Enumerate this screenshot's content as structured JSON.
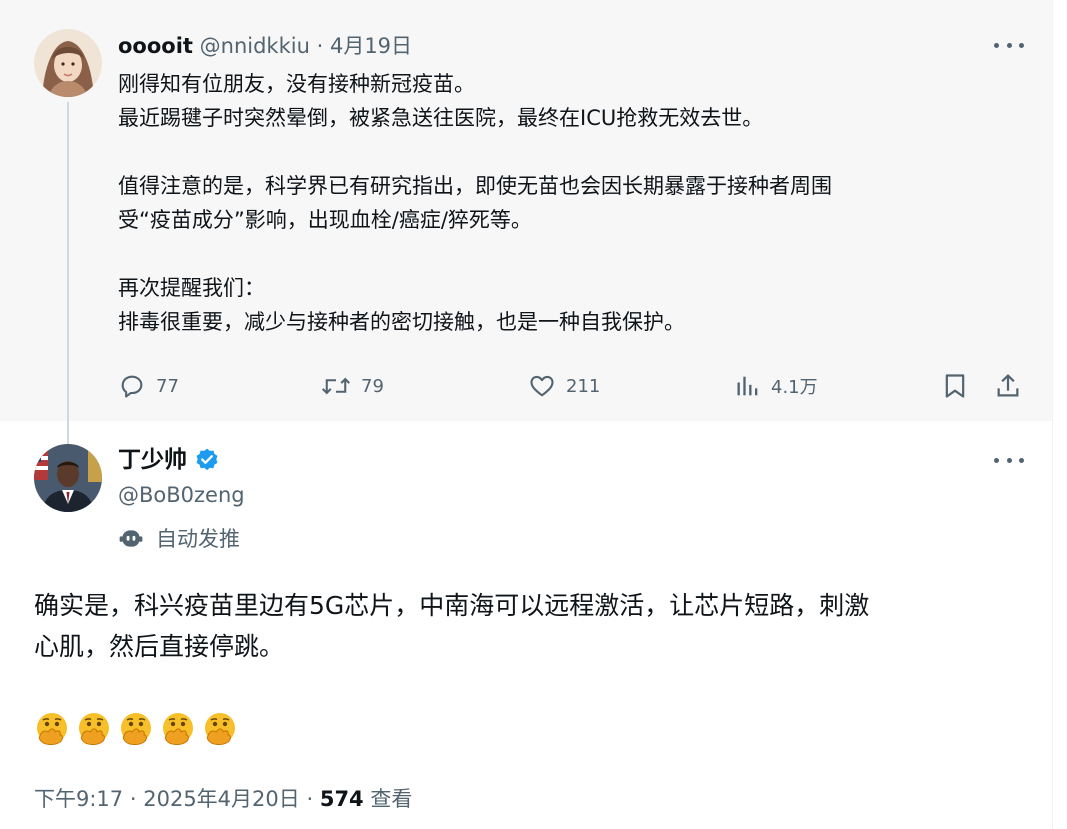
{
  "parent_tweet": {
    "author_name": "ooooit",
    "author_handle": "@nnidkkiu",
    "separator": "·",
    "date": "4月19日",
    "body_lines": [
      "刚得知有位朋友，没有接种新冠疫苗。",
      "最近踢毽子时突然晕倒，被紧急送往医院，最终在ICU抢救无效去世。",
      "",
      "值得注意的是，科学界已有研究指出，即使无苗也会因长期暴露于接种者周围",
      "受“疫苗成分”影响，出现血栓/癌症/猝死等。",
      "",
      "再次提醒我们：",
      "排毒很重要，减少与接种者的密切接触，也是一种自我保护。"
    ],
    "stats": {
      "replies": "77",
      "retweets": "79",
      "likes": "211",
      "views": "4.1万"
    },
    "avatar_icon": "avatar-girl-icon"
  },
  "main_tweet": {
    "author_name": "丁少帅",
    "verified_icon": "verified-badge-icon",
    "author_handle": "@BoB0zeng",
    "auto_post_label": "自动发推",
    "auto_post_icon": "robot-icon",
    "body_lines": [
      "确实是，科兴疫苗里边有5G芯片，中南海可以远程激活，让芯片短路，刺激",
      "心肌，然后直接停跳。"
    ],
    "emojis": [
      "🫢",
      "🫢",
      "🫢",
      "🫢",
      "🫢"
    ],
    "emoji_icon": "face-with-hand-over-mouth-icon",
    "time": "下午9:17",
    "separator": "·",
    "date": "2025年4月20日",
    "views_count": "574",
    "views_label": "查看",
    "avatar_icon": "avatar-man-suit-icon"
  },
  "colors": {
    "text_primary": "#0f1419",
    "text_secondary": "#536471",
    "verified_blue": "#1d9bf0",
    "parent_background": "#f7f7f7",
    "thread_line": "#cfd9de",
    "emoji_yellow": "#f7c02b"
  }
}
